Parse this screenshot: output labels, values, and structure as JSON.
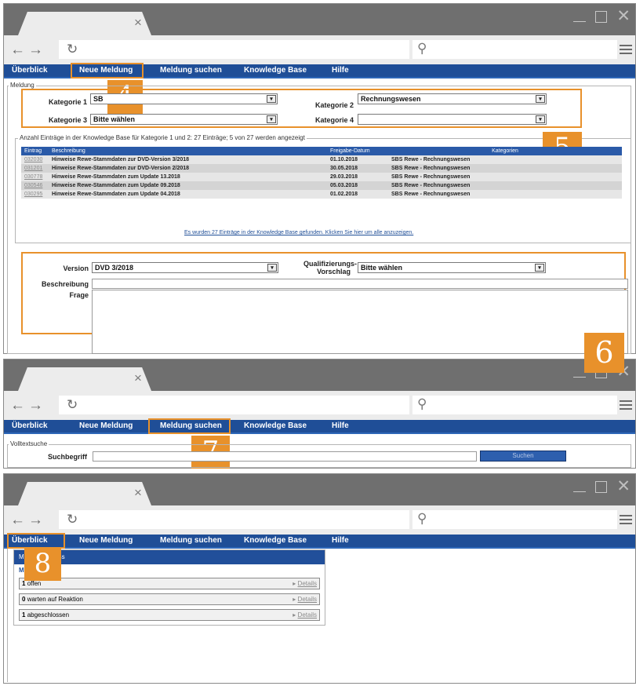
{
  "browser": {
    "tab_close": "×",
    "back_forward": "←→",
    "reload": "↻",
    "search_icon": "⚲"
  },
  "nav": [
    "Überblick",
    "Neue Meldung",
    "Meldung suchen",
    "Knowledge Base",
    "Hilfe"
  ],
  "step_badges": {
    "s4": "4",
    "s5": "5",
    "s6": "6",
    "s7": "7",
    "s8": "8"
  },
  "meldung": {
    "legend": "Meldung",
    "kat1_label": "Kategorie 1",
    "kat1_value": "SB",
    "kat2_label": "Kategorie 2",
    "kat2_value": "Rechnungswesen",
    "kat3_label": "Kategorie 3",
    "kat3_value": "Bitte wählen",
    "kat4_label": "Kategorie 4",
    "kat4_value": "",
    "dd": "▾"
  },
  "kb": {
    "legend": "Anzahl Einträge in der Knowledge Base für Kategorie 1 und 2: 27 Einträge; 5 von 27 werden angezeigt",
    "headers": [
      "Eintrag",
      "Beschreibung",
      "Freigabe-Datum",
      "Kategorien"
    ],
    "rows": [
      [
        "032030",
        "Hinweise Rewe-Stammdaten zur DVD-Version 3/2018",
        "01.10.2018",
        "SBS Rewe - Rechnungswesen"
      ],
      [
        "031201",
        "Hinweise Rewe-Stammdaten zur DVD-Version 2/2018",
        "30.05.2018",
        "SBS Rewe - Rechnungswesen"
      ],
      [
        "030778",
        "Hinweise Rewe-Stammdaten zum Update 13.2018",
        "29.03.2018",
        "SBS Rewe - Rechnungswesen"
      ],
      [
        "030546",
        "Hinweise Rewe-Stammdaten zum Update 09.2018",
        "05.03.2018",
        "SBS Rewe - Rechnungswesen"
      ],
      [
        "030295",
        "Hinweise Rewe-Stammdaten zum Update 04.2018",
        "01.02.2018",
        "SBS Rewe - Rechnungswesen"
      ]
    ],
    "more_link": "Es wurden 27 Einträge in der Knowledge Base gefunden. Klicken Sie hier um alle anzuzeigen."
  },
  "form": {
    "version_label": "Version",
    "version_value": "DVD 3/2018",
    "qual_label_1": "Qualifizierungs-",
    "qual_label_2": "Vorschlag",
    "qual_value": "Bitte wählen",
    "beschreibung_label": "Beschreibung",
    "frage_label": "Frage"
  },
  "suche": {
    "legend": "Volltextsuche",
    "term_label": "Suchbegriff",
    "button": "Suchen"
  },
  "overview": {
    "panel_title_visible": "M",
    "panel_title_tail": "ss",
    "subtitle": "Meldungen",
    "rows": [
      {
        "count": "1",
        "text": "offen",
        "details": "Details"
      },
      {
        "count": "0",
        "text": "warten auf Reaktion",
        "details": "Details"
      },
      {
        "count": "1",
        "text": "abgeschlossen",
        "details": "Details"
      }
    ]
  },
  "colors": {
    "accent": "#e8912b",
    "nav_blue": "#1f4e97",
    "titlebar": "#6f6f6f"
  }
}
